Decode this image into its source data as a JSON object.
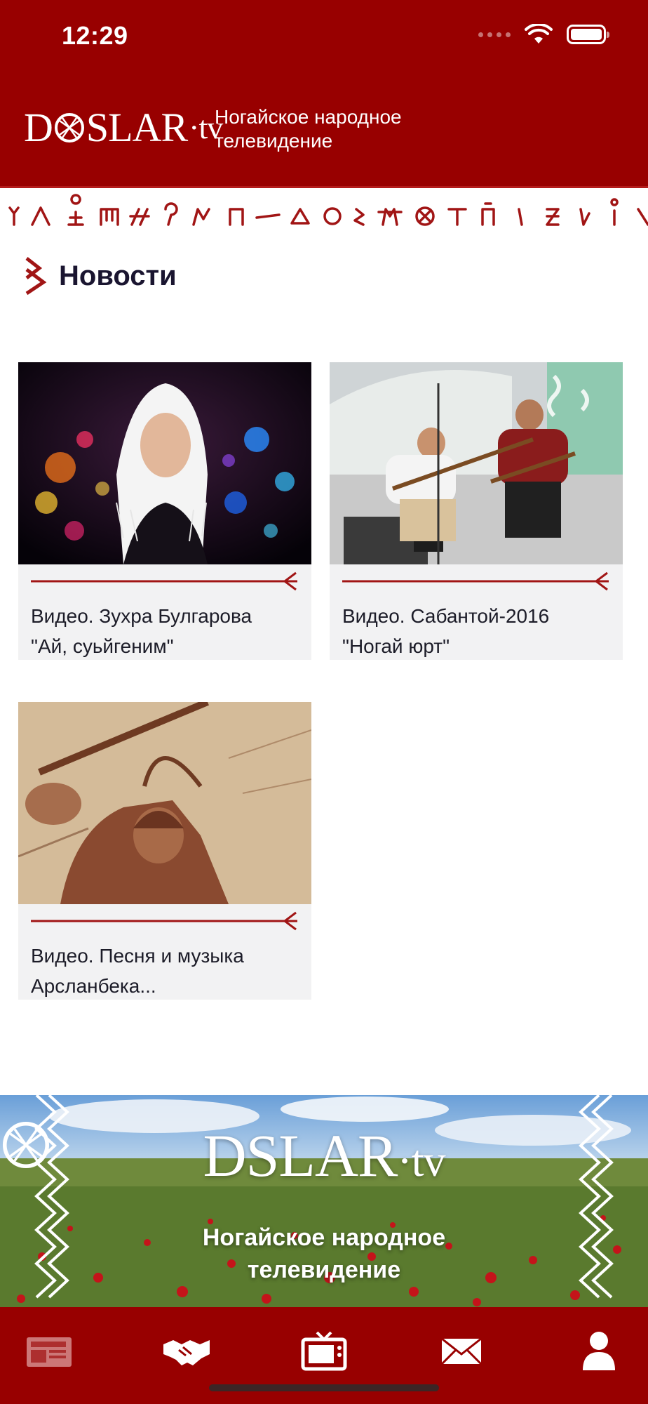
{
  "status_bar": {
    "time": "12:29"
  },
  "header": {
    "logo_text": "D SLAR·tv",
    "logo_left": "D",
    "logo_right": "SLAR",
    "logo_tv": "·tv",
    "subtitle_line1": "Ногайское народное",
    "subtitle_line2": "телевидение"
  },
  "section": {
    "title": "Новости"
  },
  "news": [
    {
      "title_line1": "Видео. Зухра Булгарова",
      "title_line2": "\"Ай, суьйгеним\""
    },
    {
      "title_line1": "Видео. Сабантой-2016",
      "title_line2": "\"Ногай юрт\""
    },
    {
      "title_line1": "Видео. Песня и музыка",
      "title_line2": "Арсланбека..."
    }
  ],
  "banner": {
    "logo_left": "D",
    "logo_right": "SLAR",
    "logo_tv": "·tv",
    "subtitle_line1": "Ногайское народное",
    "subtitle_line2": "телевидение"
  },
  "tabbar": {
    "items": [
      "news-icon",
      "handshake-icon",
      "tv-icon",
      "mail-icon",
      "user-icon"
    ],
    "active": "news-icon"
  },
  "colors": {
    "brand": "#980000",
    "card_bg": "#f2f2f3",
    "title_text": "#1a1530"
  }
}
